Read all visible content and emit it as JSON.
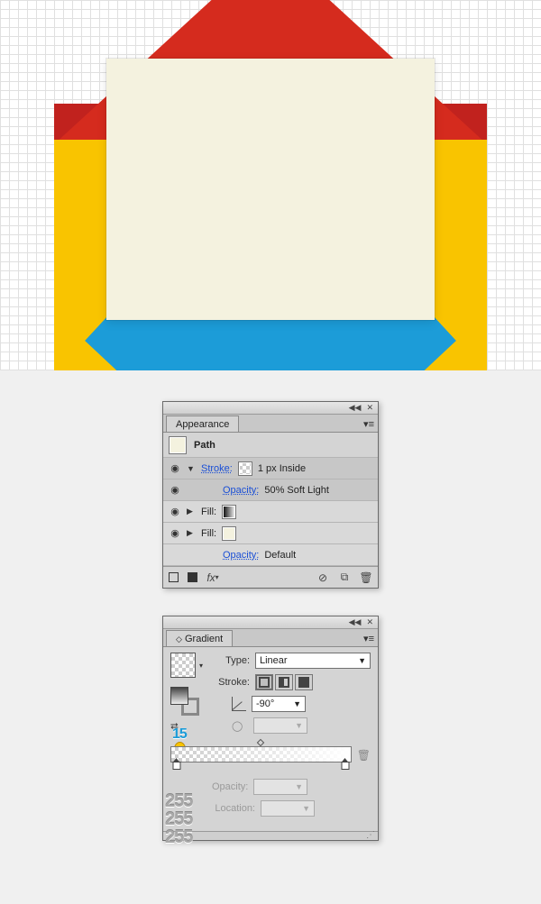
{
  "appearance": {
    "tab": "Appearance",
    "object": "Path",
    "stroke_label": "Stroke:",
    "stroke_value": "1 px  Inside",
    "stroke_opacity_label": "Opacity:",
    "stroke_opacity_value": "50% Soft Light",
    "fill_label": "Fill:",
    "default_opacity_label": "Opacity:",
    "default_opacity_value": "Default",
    "fx_label": "fx"
  },
  "gradient": {
    "tab": "Gradient",
    "type_label": "Type:",
    "type_value": "Linear",
    "stroke_label": "Stroke:",
    "angle_value": "-90°",
    "aspect_value": "",
    "opacity_label": "Opacity:",
    "opacity_value": "",
    "location_label": "Location:",
    "location_value": "",
    "annotations": {
      "fifteen": "15",
      "r": "255",
      "g": "255",
      "b": "255"
    }
  },
  "chart_data": {
    "type": "gradient",
    "angle": -90,
    "stops": [
      {
        "position": 0,
        "color": [
          255,
          255,
          255
        ],
        "opacity": 15
      },
      {
        "position": 100,
        "color": [
          255,
          255,
          255
        ],
        "opacity": 0
      }
    ]
  }
}
